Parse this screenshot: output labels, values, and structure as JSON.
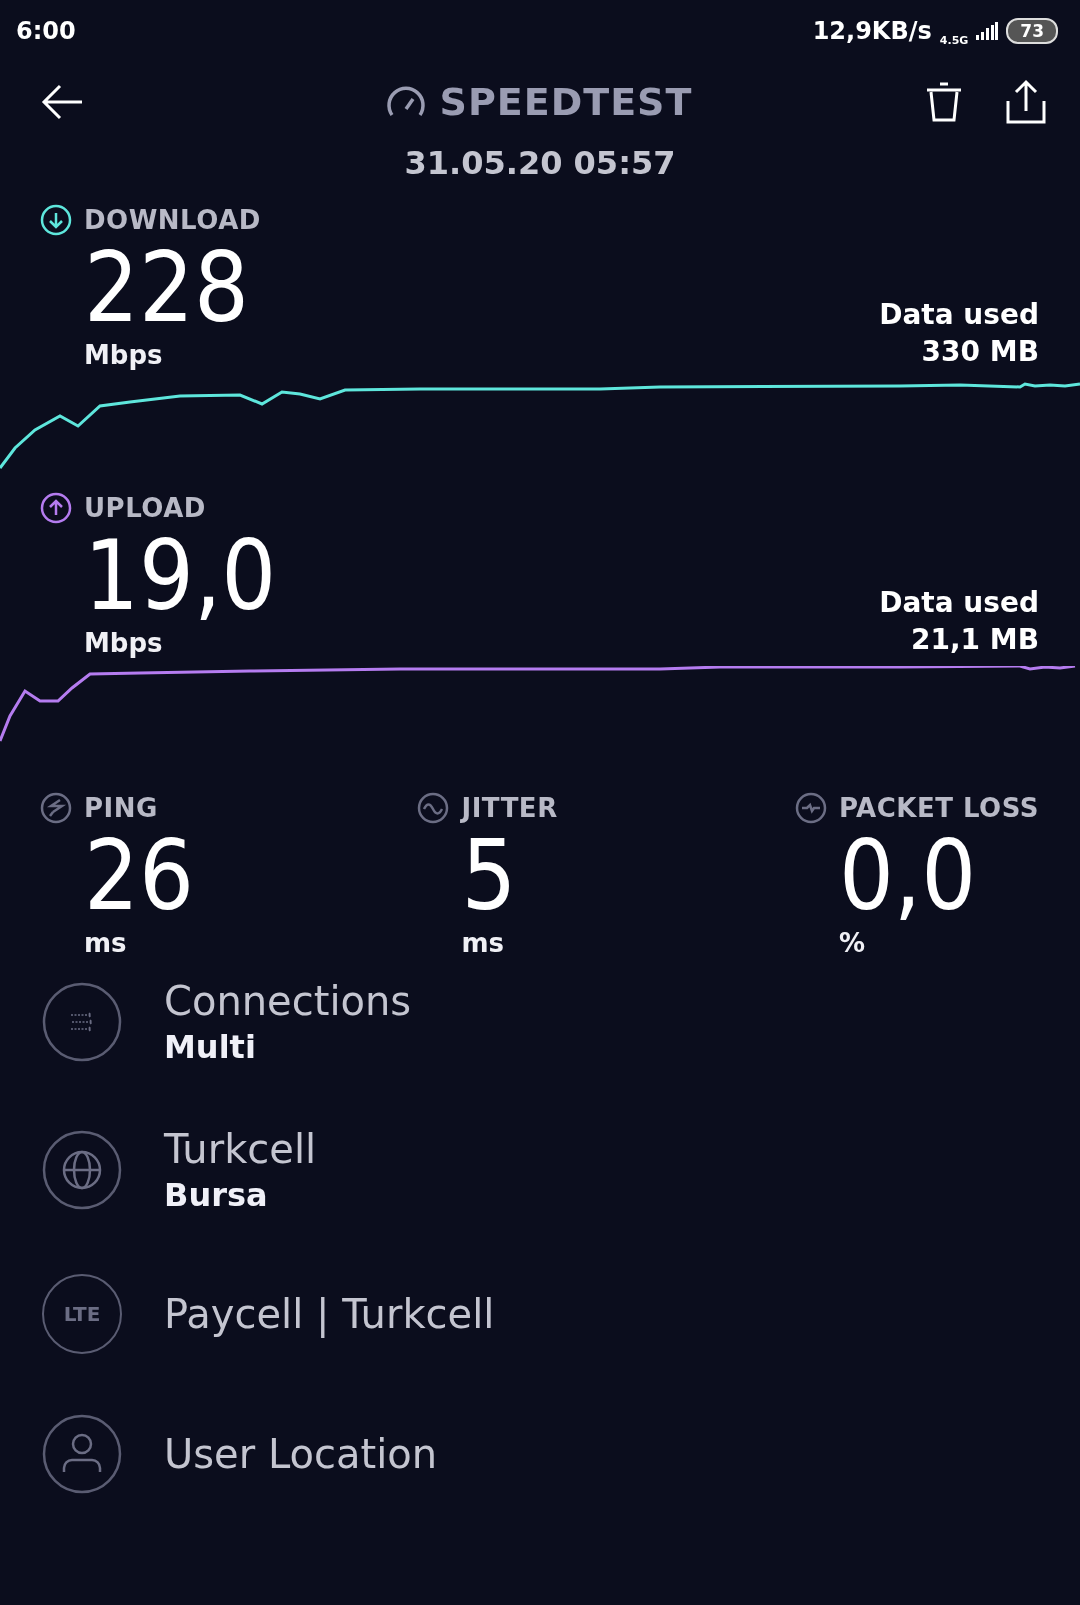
{
  "status_bar": {
    "time": "6:00",
    "net_speed": "12,9KB/s",
    "network_type": "4.5G",
    "battery": "73"
  },
  "header": {
    "title": "SPEEDTEST",
    "date": "31.05.20 05:57"
  },
  "speeds": [
    {
      "kind": "download",
      "label": "DOWNLOAD",
      "value": "228",
      "unit": "Mbps",
      "data_label": "Data used",
      "data_value": "330 MB",
      "color": "#5ee6dc"
    },
    {
      "kind": "upload",
      "label": "UPLOAD",
      "value": "19,0",
      "unit": "Mbps",
      "data_label": "Data used",
      "data_value": "21,1 MB",
      "color": "#b57cf0"
    }
  ],
  "metrics": [
    {
      "kind": "ping",
      "label": "PING",
      "value": "26",
      "unit": "ms"
    },
    {
      "kind": "jitter",
      "label": "JITTER",
      "value": "5",
      "unit": "ms"
    },
    {
      "kind": "packet_loss",
      "label": "PACKET LOSS",
      "value": "0,0",
      "unit": "%"
    }
  ],
  "details": [
    {
      "kind": "connections",
      "title": "Connections",
      "subtitle": "Multi"
    },
    {
      "kind": "server",
      "title": "Turkcell",
      "subtitle": "Bursa"
    },
    {
      "kind": "network",
      "badge": "LTE",
      "title": "Paycell | Turkcell"
    },
    {
      "kind": "user",
      "title": "User Location"
    }
  ]
}
